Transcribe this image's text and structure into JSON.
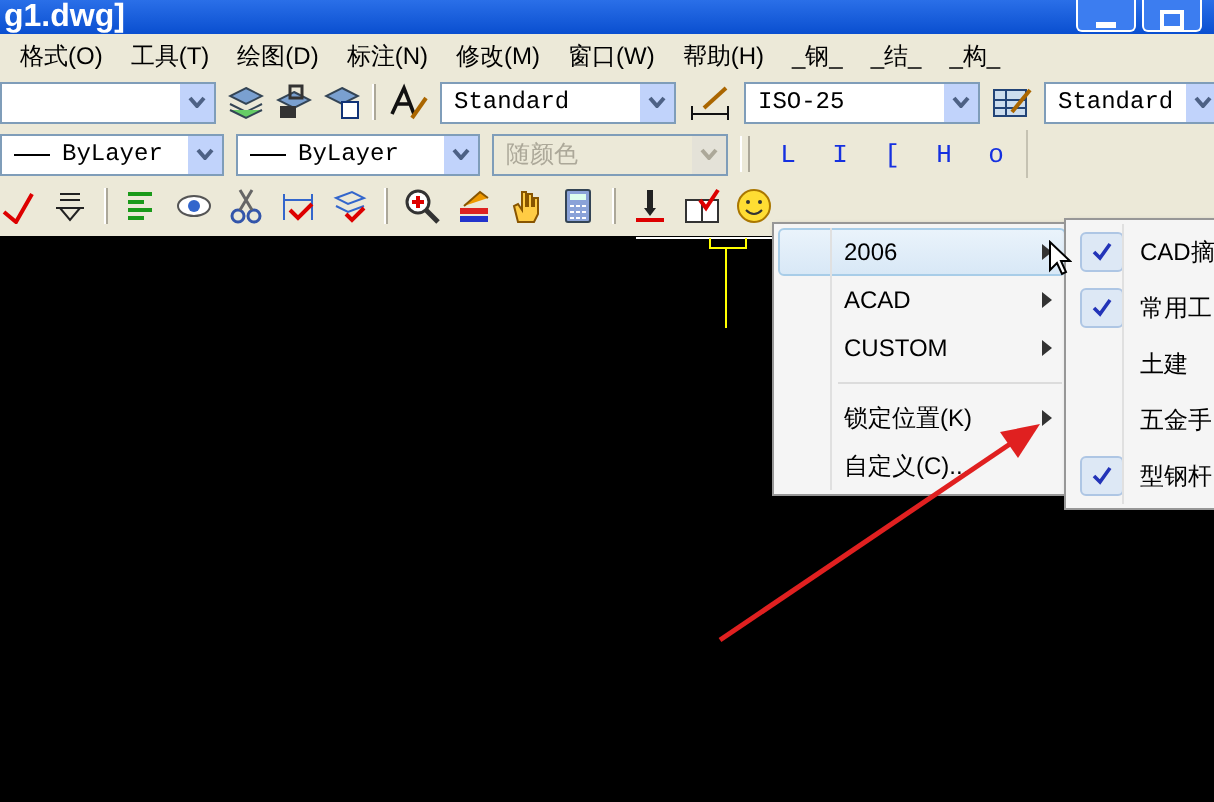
{
  "title_bar": {
    "title": "g1.dwg]"
  },
  "menu_bar": [
    "格式(O)",
    "工具(T)",
    "绘图(D)",
    "标注(N)",
    "修改(M)",
    "窗口(W)",
    "帮助(H)",
    "_钢_",
    "_结_",
    "_构_"
  ],
  "styles_toolbar": {
    "text_style": "Standard",
    "dim_style": "ISO-25",
    "table_style": "Standard"
  },
  "properties_toolbar": {
    "color_dropdown": "ByLayer",
    "linetype": "ByLayer",
    "lineweight": {
      "value": "随颜色",
      "disabled": true
    }
  },
  "shape_toolbar": [
    "L",
    "I",
    "[",
    "H",
    "o"
  ],
  "context_menu": [
    {
      "kind": "submenu",
      "label": "2006",
      "selected": true
    },
    {
      "kind": "submenu",
      "label": "ACAD",
      "selected": false
    },
    {
      "kind": "submenu",
      "label": "CUSTOM",
      "selected": false
    },
    {
      "kind": "separator"
    },
    {
      "kind": "submenu",
      "label": "锁定位置(K)",
      "selected": false
    },
    {
      "kind": "command",
      "label": "自定义(C)...",
      "selected": false
    }
  ],
  "submenu": [
    {
      "label": "CAD摘",
      "checked": true
    },
    {
      "label": "常用工",
      "checked": true
    },
    {
      "label": "土建",
      "checked": false
    },
    {
      "label": "五金手",
      "checked": false
    },
    {
      "label": "型钢杆",
      "checked": true
    }
  ]
}
